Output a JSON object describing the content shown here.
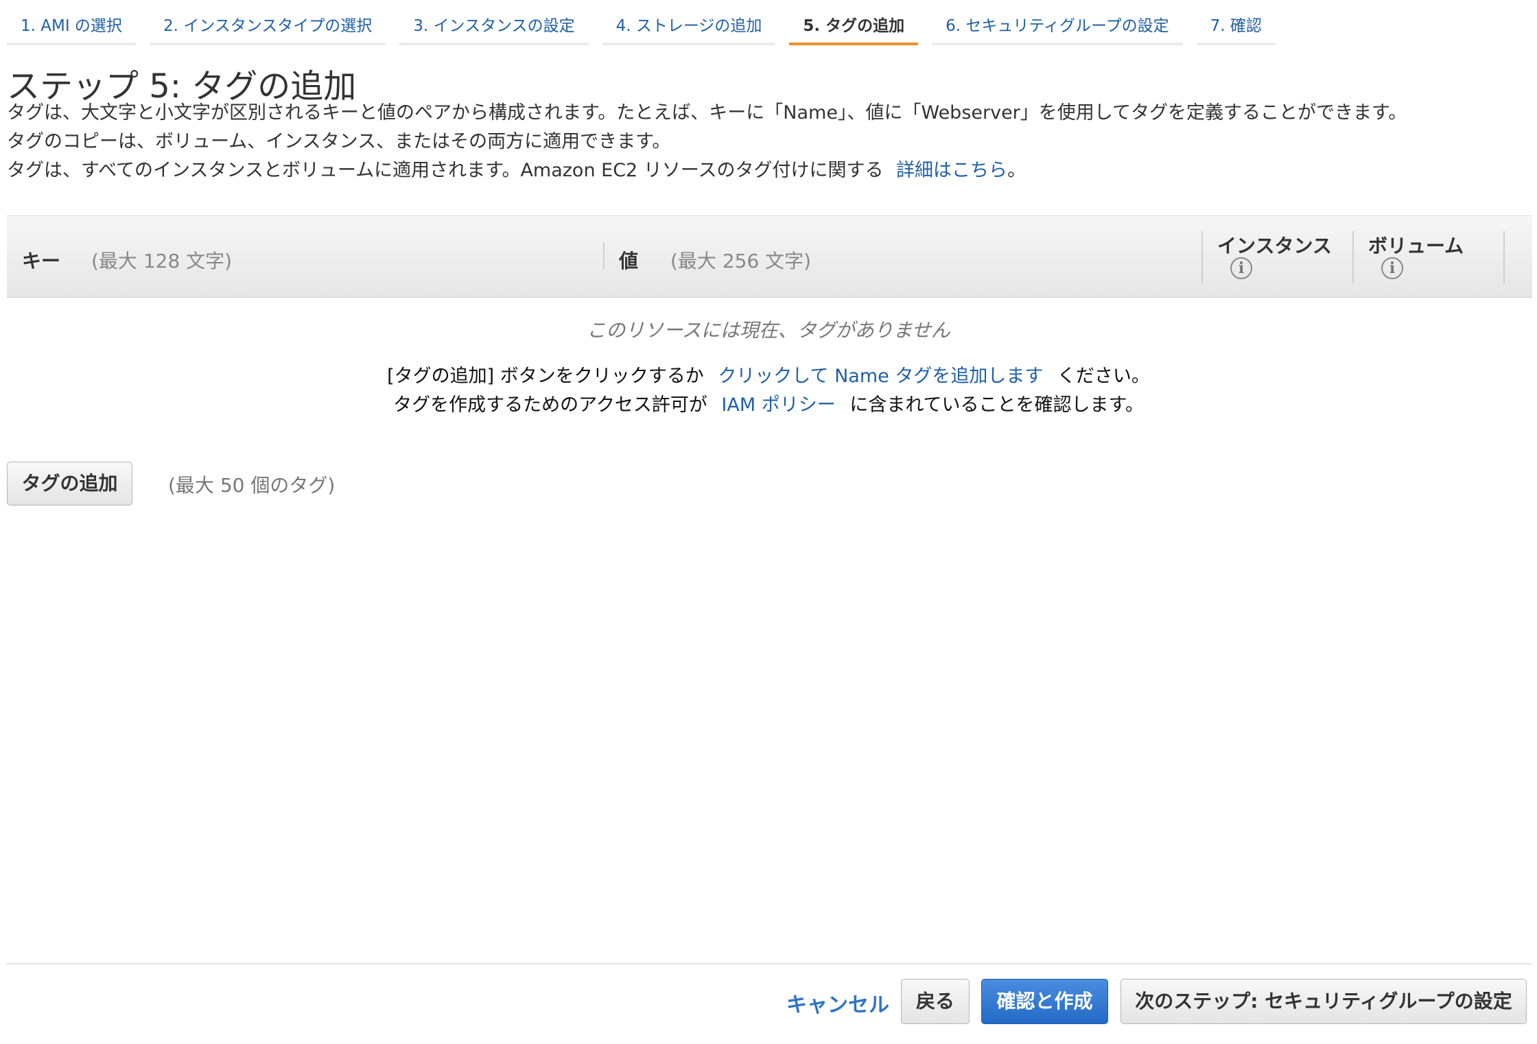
{
  "wizard": {
    "steps": [
      {
        "label": "1. AMI の選択"
      },
      {
        "label": "2. インスタンスタイプの選択"
      },
      {
        "label": "3. インスタンスの設定"
      },
      {
        "label": "4. ストレージの追加"
      },
      {
        "label": "5. タグの追加"
      },
      {
        "label": "6. セキュリティグループの設定"
      },
      {
        "label": "7. 確認"
      }
    ],
    "active_step": 4,
    "accent_color": "#ec912d",
    "link_color": "#1f5fa7"
  },
  "page": {
    "title": "ステップ 5: タグの追加",
    "desc_line1": "タグは、大文字と小文字が区別されるキーと値のペアから構成されます。たとえば、キーに「Name」、値に「Webserver」を使用してタグを定義することができます。",
    "desc_line2": "タグのコピーは、ボリューム、インスタンス、またはその両方に適用できます。",
    "desc_line3_text": "タグは、すべてのインスタンスとボリュームに適用されます。Amazon EC2 リソースのタグ付けに関する",
    "desc_line3_link": "詳細はこちら",
    "desc_line3_end": "。"
  },
  "table": {
    "key_header": "キー",
    "key_hint": "(最大 128 文字)",
    "value_header": "値",
    "value_hint": "(最大 256 文字)",
    "instance_header": "インスタンス",
    "volume_header": "ボリューム",
    "info_icon_glyph": "i"
  },
  "empty_state": {
    "message": "このリソースには現在、タグがありません",
    "line1_prefix": "[タグの追加] ボタンをクリックするか",
    "line1_link": "クリックして Name タグを追加します",
    "line1_suffix": "ください。",
    "line2_prefix": "タグを作成するためのアクセス許可が",
    "line2_link": "IAM ポリシー",
    "line2_suffix": "に含まれていることを確認します。"
  },
  "actions": {
    "add_tag_label": "タグの追加",
    "max_tags_hint": "(最大 50 個のタグ)"
  },
  "footer": {
    "cancel_label": "キャンセル",
    "back_label": "戻る",
    "review_launch_label": "確認と作成",
    "next_label": "次のステップ: セキュリティグループの設定",
    "primary_color": "#236bc6"
  }
}
